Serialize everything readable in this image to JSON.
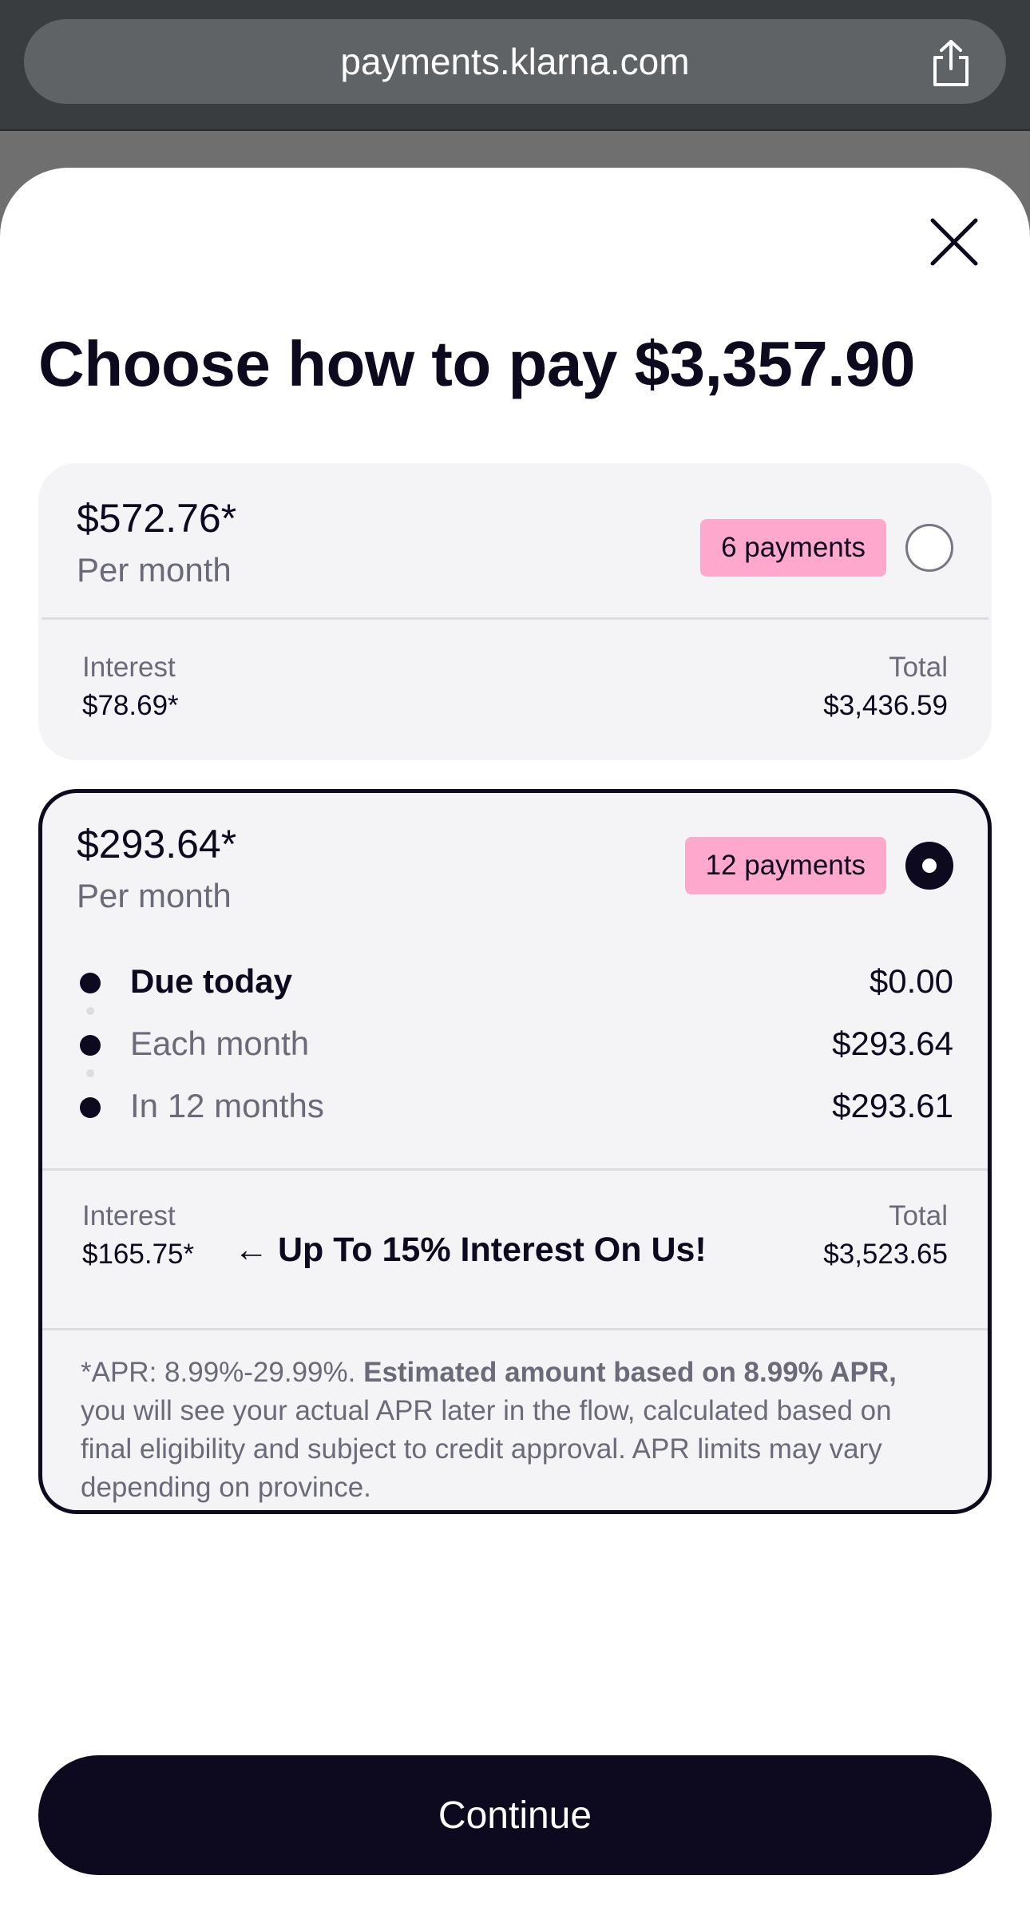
{
  "browser": {
    "url": "payments.klarna.com",
    "share_icon": "share-icon"
  },
  "sheet": {
    "close_icon": "close-icon",
    "title": "Choose how to pay $3,357.90"
  },
  "options": [
    {
      "monthly_amount": "$572.76*",
      "per_month_label": "Per month",
      "badge": "6 payments",
      "selected": false,
      "interest_label": "Interest",
      "interest_value": "$78.69*",
      "total_label": "Total",
      "total_value": "$3,436.59"
    },
    {
      "monthly_amount": "$293.64*",
      "per_month_label": "Per month",
      "badge": "12 payments",
      "selected": true,
      "schedule": [
        {
          "label": "Due today",
          "value": "$0.00"
        },
        {
          "label": "Each month",
          "value": "$293.64"
        },
        {
          "label": "In 12 months",
          "value": "$293.61"
        }
      ],
      "interest_label": "Interest",
      "interest_value": "$165.75*",
      "promo": "← Up To 15% Interest On Us!",
      "total_label": "Total",
      "total_value": "$3,523.65",
      "disclaimer": {
        "part1": "*APR: 8.99%-29.99%. ",
        "bold": "Estimated amount based on 8.99% APR,",
        "part2": " you will see your actual APR later in the flow, calculated based on final eligibility and subject to credit approval. APR limits may vary depending on province."
      }
    }
  ],
  "continue_label": "Continue",
  "colors": {
    "brand_dark": "#0d0a1f",
    "badge_pink": "#ffa8cd",
    "card_bg": "#f4f4f7",
    "muted_text": "#6a6a78"
  }
}
